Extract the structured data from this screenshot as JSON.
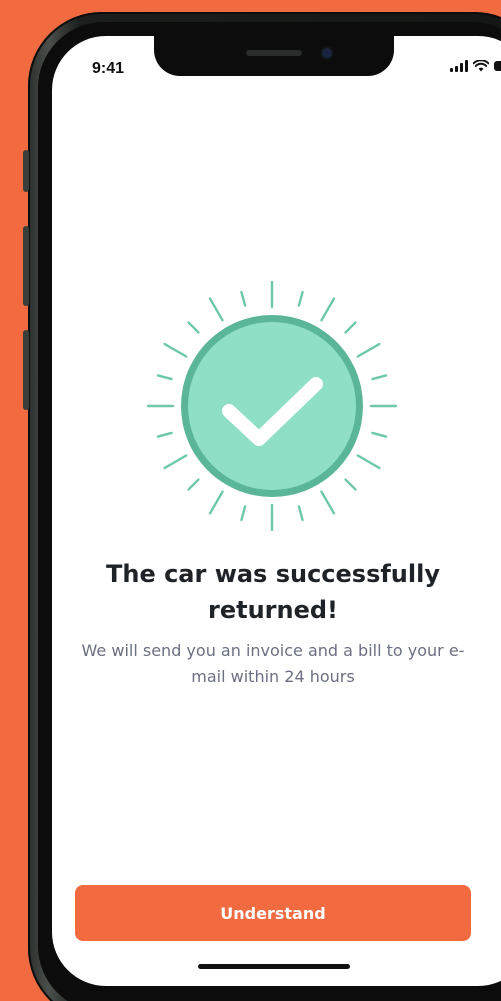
{
  "status_bar": {
    "time": "9:41",
    "icons": [
      "cellular-signal-icon",
      "wifi-icon",
      "battery-icon"
    ]
  },
  "illustration": {
    "icon": "checkmark-icon",
    "circle_fill": "#8fdfc7",
    "circle_ring": "#5bb598",
    "ray_color": "#6cc8a8",
    "check_color": "#ffffff"
  },
  "message": {
    "title": "The car was successfully returned!",
    "body": "We will send you an invoice and a bill to your e-mail within 24 hours"
  },
  "actions": {
    "understand_label": "Understand"
  },
  "theme": {
    "accent": "#f26a3f",
    "background": "#f26a3f",
    "screen": "#ffffff",
    "title_color": "#1f2328",
    "body_color": "#6a7080"
  }
}
